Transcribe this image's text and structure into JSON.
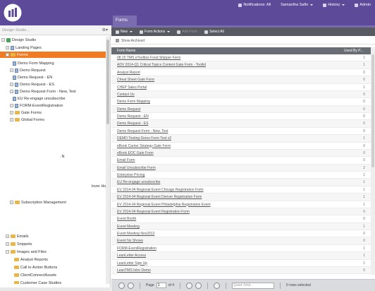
{
  "topbar": {
    "notifications_label": "Notifications: All",
    "user_label": "Samantha Safin",
    "history_label": "History",
    "admin_label": "Admin",
    "brand_color": "#5d4a99"
  },
  "left_panel": {
    "search_placeholder": "Design Studio...",
    "tree": [
      {
        "label": "Design Studio",
        "icon": "design-studio-icon"
      },
      {
        "label": "Landing Pages",
        "icon": "landing-pages-icon"
      },
      {
        "label": "Forms",
        "icon": "forms-icon",
        "selected": true
      },
      {
        "label": "Demo Form Mapping",
        "icon": "form-icon"
      },
      {
        "label": "Demo Request",
        "icon": "form-icon"
      },
      {
        "label": "Demo Request - EN",
        "icon": "form-icon"
      },
      {
        "label": "Demo Request - ES",
        "icon": "form-icon"
      },
      {
        "label": "Demo Request Form - New, Test",
        "icon": "form-icon"
      },
      {
        "label": "EU Re-engage unsubscribe",
        "icon": "form-icon"
      },
      {
        "label": "FORM-EventRegistration",
        "icon": "form-icon"
      },
      {
        "label": "Gate Forms",
        "icon": "folder-icon"
      },
      {
        "label": "Global Forms",
        "icon": "folder-icon"
      },
      {
        "label": ".N",
        "icon": ""
      },
      {
        "label": "lover Ho",
        "icon": ""
      },
      {
        "label": "Subscription Management",
        "icon": "folder-icon"
      },
      {
        "label": "Emails",
        "icon": "emails-icon"
      },
      {
        "label": "Snippets",
        "icon": "snippets-icon"
      },
      {
        "label": "Images and Files",
        "icon": "images-files-icon"
      },
      {
        "label": "Analyst Reports",
        "icon": "folder-icon"
      },
      {
        "label": "Call to Action Buttons",
        "icon": "folder-icon"
      },
      {
        "label": "ClientConnectAssets",
        "icon": "folder-icon"
      },
      {
        "label": "Customer Case Studies",
        "icon": "folder-icon"
      },
      {
        "label": "Data Sheets",
        "icon": "folder-icon"
      }
    ]
  },
  "main": {
    "tab_label": "Forms",
    "toolbar": {
      "new_label": "New",
      "form_actions_label": "Form Actions",
      "add_form_label": "Add Form",
      "select_all_label": "Select All"
    },
    "show_archived_label": "Show Archived",
    "columns": {
      "name": "Form Name",
      "used_by": "Used By P..."
    },
    "rows": [
      {
        "name": "08.15 TMS eToolbox Food Shipper Form",
        "count": "1"
      },
      {
        "name": "ADV 2014-Q1 Critical Topics Content Gate Form - Toolkit",
        "count": "1"
      },
      {
        "name": "Analyst Report",
        "count": "0"
      },
      {
        "name": "Cheat Sheet Gate Form",
        "count": "0"
      },
      {
        "name": "CHEP Sales Portal",
        "count": "1"
      },
      {
        "name": "Contact Us",
        "count": "0"
      },
      {
        "name": "Demo Form Mapping",
        "count": "0"
      },
      {
        "name": "Demo Request",
        "count": "0"
      },
      {
        "name": "Demo Request - EN",
        "count": "0"
      },
      {
        "name": "Demo Request - ES",
        "count": "0"
      },
      {
        "name": "Demo Request Form - New, Test",
        "count": "0"
      },
      {
        "name": "DEMO Testing Demo Form Test v2",
        "count": "1"
      },
      {
        "name": "eBook Carrier Strategy Gate Form",
        "count": "0"
      },
      {
        "name": "eBook EOC Gate Form",
        "count": "0"
      },
      {
        "name": "Email Form",
        "count": "0"
      },
      {
        "name": "Email Unsubscribe Form",
        "count": "2"
      },
      {
        "name": "Enterprise Pricing",
        "count": "1"
      },
      {
        "name": "EU Re-engage unsubscribe",
        "count": "1"
      },
      {
        "name": "EV 2014-04 Regional Event Chicago Registration Form",
        "count": "1"
      },
      {
        "name": "EV 2014-04 Regional Event Denver Registration Form",
        "count": "1"
      },
      {
        "name": "EV 2014-04 Regional Event Philadelphia Registration Event",
        "count": "1"
      },
      {
        "name": "EV 2014-04 Regional Event Registration Form",
        "count": "0"
      },
      {
        "name": "Event Booth",
        "count": "0"
      },
      {
        "name": "Event Meeting",
        "count": "1"
      },
      {
        "name": "Event Meeting Nov2012",
        "count": "0"
      },
      {
        "name": "Event No Shows",
        "count": "0"
      },
      {
        "name": "FORM-EventRegistration",
        "count": "1"
      },
      {
        "name": "LeanLetter Access",
        "count": "1"
      },
      {
        "name": "LeanLetter Sign Up",
        "count": "1"
      },
      {
        "name": "LeanTMS Intro Demo",
        "count": "0"
      }
    ],
    "pager": {
      "page_label": "Page",
      "page_value": "1",
      "of_label": "of 4",
      "find_placeholder": "Quick Find...",
      "selected_label": "0 rows selected"
    }
  }
}
